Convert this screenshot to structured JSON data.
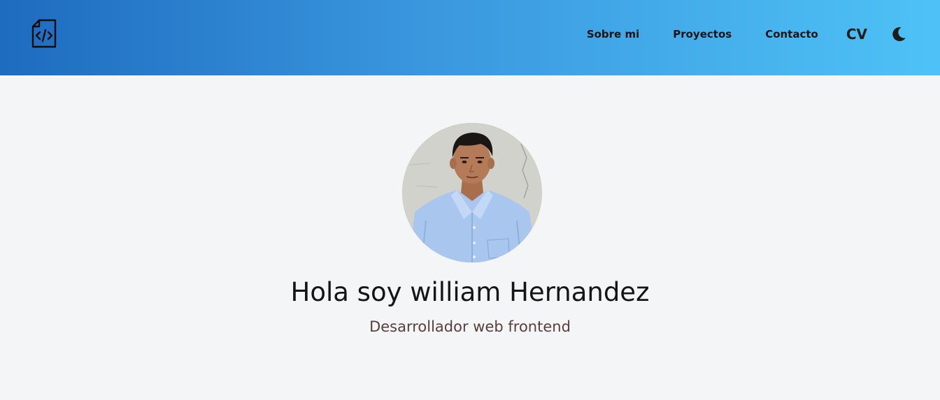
{
  "header": {
    "logo_icon": "code-file-icon",
    "nav": {
      "sobre_mi": "Sobre mi",
      "proyectos": "Proyectos",
      "contacto": "Contacto",
      "cv": "CV"
    },
    "theme_icon": "moon-icon"
  },
  "hero": {
    "title": "Hola soy william Hernandez",
    "subtitle": "Desarrollador web frontend"
  },
  "colors": {
    "header_gradient_start": "#1e6bbf",
    "header_gradient_end": "#4ec2f6",
    "page_background": "#f4f5f7",
    "title_color": "#151515",
    "subtitle_color": "#5a3e3a"
  }
}
